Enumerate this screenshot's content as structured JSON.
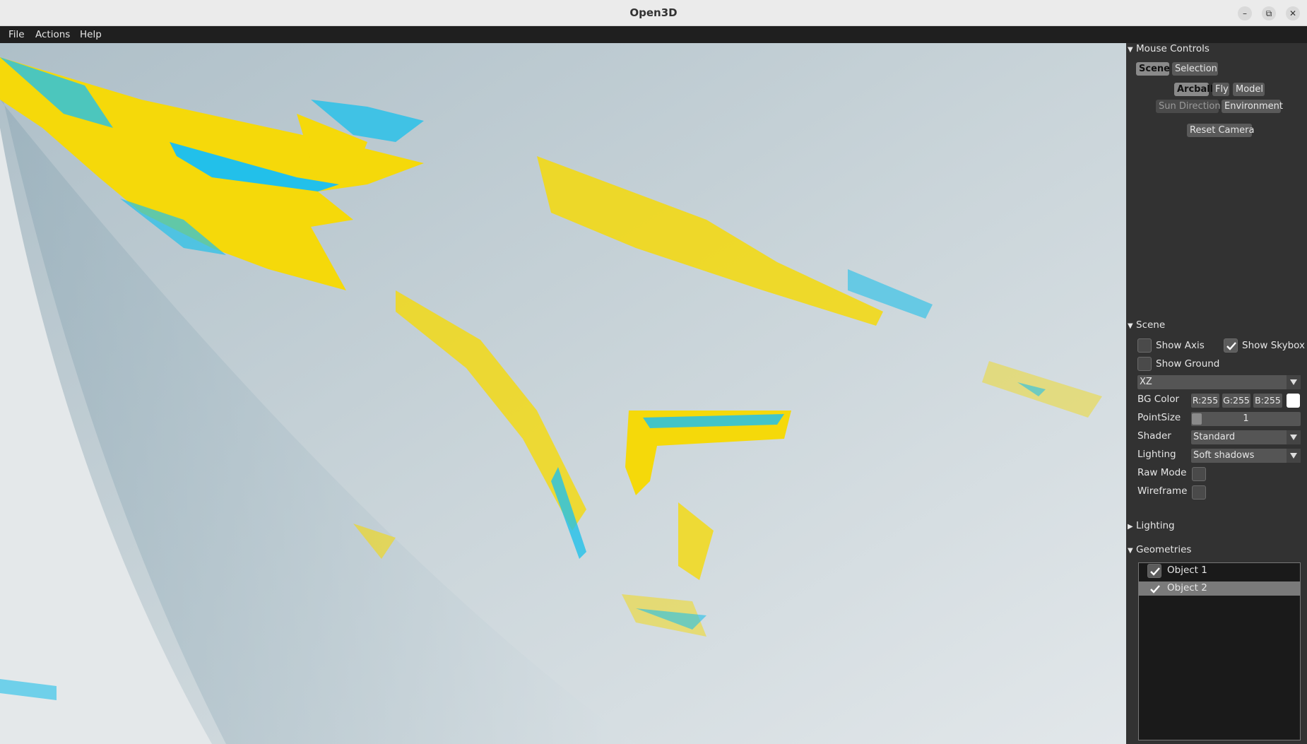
{
  "window": {
    "title": "Open3D",
    "controls": [
      "–",
      "⧉",
      "✕"
    ]
  },
  "menubar": {
    "items": [
      "File",
      "Actions",
      "Help"
    ]
  },
  "colors": {
    "object1": "#f5d90a",
    "object2": "#22c0ea",
    "panel_bg": "#323232",
    "selection": "#7a7a7a"
  },
  "panel": {
    "mouse_controls": {
      "header": "Mouse Controls",
      "tabs": [
        "Scene",
        "Selection"
      ],
      "modes_row1": [
        "Arcball",
        "Fly",
        "Model"
      ],
      "modes_row2": [
        "Sun Direction",
        "Environment"
      ],
      "reset_label": "Reset Camera"
    },
    "scene": {
      "header": "Scene",
      "show_axis": {
        "label": "Show Axis",
        "checked": false
      },
      "show_skybox": {
        "label": "Show Skybox",
        "checked": true
      },
      "show_ground": {
        "label": "Show Ground",
        "checked": false
      },
      "ground_plane": "XZ",
      "bg_color": {
        "label": "BG Color",
        "r": "R:255",
        "g": "G:255",
        "b": "B:255",
        "swatch": "#ffffff"
      },
      "point_size": {
        "label": "PointSize",
        "value": "1"
      },
      "shader": {
        "label": "Shader",
        "value": "Standard"
      },
      "lighting": {
        "label": "Lighting",
        "value": "Soft shadows"
      },
      "raw_mode": {
        "label": "Raw Mode",
        "checked": false
      },
      "wireframe": {
        "label": "Wireframe",
        "checked": false
      }
    },
    "lighting_section": {
      "header": "Lighting"
    },
    "geometries": {
      "header": "Geometries",
      "items": [
        {
          "label": "Object 1",
          "checked": true,
          "selected": false
        },
        {
          "label": "Object 2",
          "checked": true,
          "selected": true
        }
      ]
    }
  }
}
